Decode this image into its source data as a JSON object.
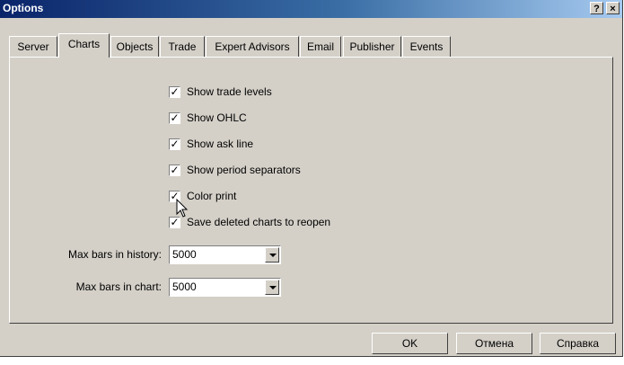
{
  "window": {
    "title": "Options",
    "help_btn": "?",
    "close_btn": "×"
  },
  "tabs": [
    {
      "label": "Server",
      "active": false
    },
    {
      "label": "Charts",
      "active": true
    },
    {
      "label": "Objects",
      "active": false
    },
    {
      "label": "Trade",
      "active": false
    },
    {
      "label": "Expert Advisors",
      "active": false
    },
    {
      "label": "Email",
      "active": false
    },
    {
      "label": "Publisher",
      "active": false
    },
    {
      "label": "Events",
      "active": false
    }
  ],
  "options": [
    {
      "label": "Show trade levels",
      "checked": true
    },
    {
      "label": "Show OHLC",
      "checked": true
    },
    {
      "label": "Show ask line",
      "checked": true
    },
    {
      "label": "Show period separators",
      "checked": true
    },
    {
      "label": "Color print",
      "checked": true
    },
    {
      "label": "Save deleted charts to reopen",
      "checked": true
    }
  ],
  "fields": {
    "max_bars_history": {
      "label": "Max bars in history:",
      "value": "5000"
    },
    "max_bars_chart": {
      "label": "Max bars in chart:",
      "value": "5000"
    }
  },
  "buttons": {
    "ok": "OK",
    "cancel": "Отмена",
    "help": "Справка"
  },
  "checkmark": "✓"
}
